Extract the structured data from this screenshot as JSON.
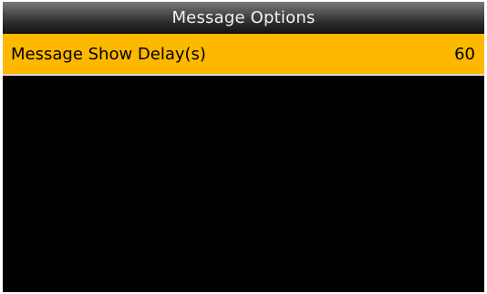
{
  "header": {
    "title": "Message Options"
  },
  "menu": {
    "items": [
      {
        "label": "Message Show Delay(s)",
        "value": "60",
        "selected": true
      }
    ]
  },
  "colors": {
    "selected_row": "#ffb800",
    "screen_background": "#000000",
    "title_text": "#f2f2f2"
  }
}
